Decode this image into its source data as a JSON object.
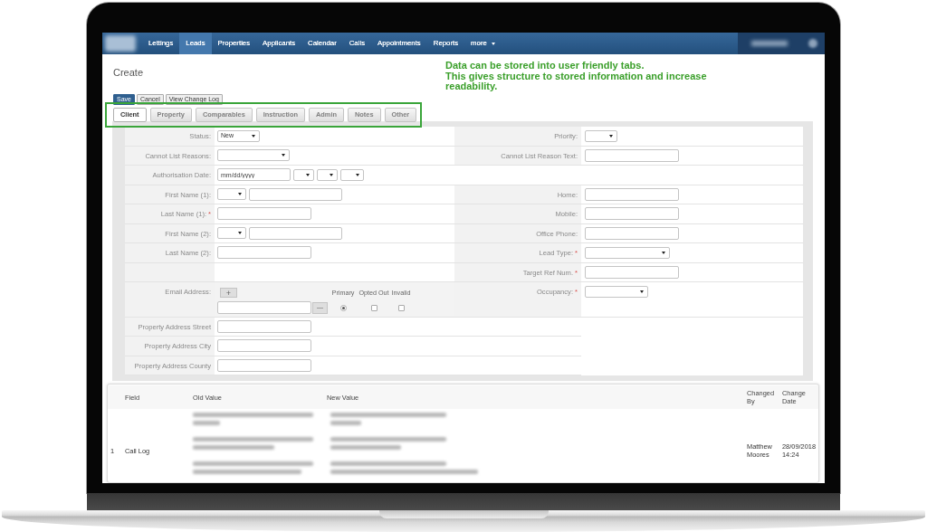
{
  "navbar": {
    "items": [
      {
        "label": "Lettings",
        "selected": false
      },
      {
        "label": "Leads",
        "selected": true
      },
      {
        "label": "Properties",
        "selected": false
      },
      {
        "label": "Applicants",
        "selected": false
      },
      {
        "label": "Calendar",
        "selected": false
      },
      {
        "label": "Calls",
        "selected": false
      },
      {
        "label": "Appointments",
        "selected": false
      },
      {
        "label": "Reports",
        "selected": false
      },
      {
        "label": "more",
        "selected": false,
        "dropdown": true
      }
    ]
  },
  "page": {
    "title": "Create"
  },
  "callout": [
    "Data can be stored into user friendly tabs.",
    "This gives structure to stored information and increase readability."
  ],
  "actions": [
    {
      "label": "Save",
      "kind": "primary"
    },
    {
      "label": "Cancel",
      "kind": "default"
    },
    {
      "label": "View Change Log",
      "kind": "default"
    }
  ],
  "tabs": [
    {
      "label": "Client",
      "selected": true
    },
    {
      "label": "Property",
      "selected": false
    },
    {
      "label": "Comparables",
      "selected": false
    },
    {
      "label": "Instruction",
      "selected": false
    },
    {
      "label": "Admin",
      "selected": false
    },
    {
      "label": "Notes",
      "selected": false
    },
    {
      "label": "Other",
      "selected": false
    }
  ],
  "form": {
    "rows": [
      {
        "left": {
          "label": "Status:",
          "field": {
            "kind": "select",
            "value": "New"
          }
        },
        "right": {
          "label": "Priority:",
          "field": {
            "kind": "select"
          }
        }
      },
      {
        "left": {
          "label": "Cannot List Reasons:",
          "field": {
            "kind": "select"
          }
        },
        "right": {
          "label": "Cannot List Reason Text:",
          "field": {
            "kind": "text"
          }
        }
      },
      {
        "left": {
          "label": "Authorisation Date:",
          "field": {
            "kind": "date",
            "placeholder": "mm/dd/yyyy"
          }
        }
      },
      {
        "left": {
          "label": "First Name (1):",
          "field": {
            "kind": "name"
          }
        },
        "right": {
          "label": "Home:",
          "field": {
            "kind": "text"
          }
        }
      },
      {
        "left": {
          "label": "Last Name (1):",
          "mark": "*",
          "field": {
            "kind": "text"
          }
        },
        "right": {
          "label": "Mobile:",
          "field": {
            "kind": "text"
          }
        }
      },
      {
        "left": {
          "label": "First Name (2):",
          "field": {
            "kind": "name"
          }
        },
        "right": {
          "label": "Office Phone:",
          "field": {
            "kind": "text"
          }
        }
      },
      {
        "left": {
          "label": "Last Name (2):",
          "field": {
            "kind": "text"
          }
        },
        "right": {
          "label": "Lead Type:",
          "mark": "*",
          "field": {
            "kind": "select"
          }
        }
      },
      {
        "right": {
          "label": "Target Ref Num.",
          "mark": "*",
          "field": {
            "kind": "text"
          }
        }
      },
      {
        "left": {
          "label": "Email Address:",
          "field": {
            "kind": "email",
            "add": "+",
            "remove": "—",
            "columns": [
              "Primary",
              "Opted Out",
              "Invalid"
            ],
            "entries": [
              {
                "primary": true,
                "opted_out": false,
                "invalid": false
              }
            ]
          }
        },
        "right": {
          "label": "Occupancy:",
          "mark": "*",
          "field": {
            "kind": "select"
          }
        }
      }
    ],
    "address_rows": [
      {
        "label": "Property Address Street",
        "field": {
          "kind": "text"
        }
      },
      {
        "label": "Property Address City",
        "field": {
          "kind": "text"
        }
      },
      {
        "label": "Property Address County",
        "field": {
          "kind": "text"
        }
      }
    ]
  },
  "change_log": {
    "columns": [
      "Field",
      "Old Value",
      "New Value",
      "Changed By",
      "Change Date"
    ],
    "rows": [
      {
        "number": "1",
        "field": "Call Log",
        "changed_by": "Matthew Moores",
        "change_date": "28/09/2018 14:24"
      }
    ]
  }
}
